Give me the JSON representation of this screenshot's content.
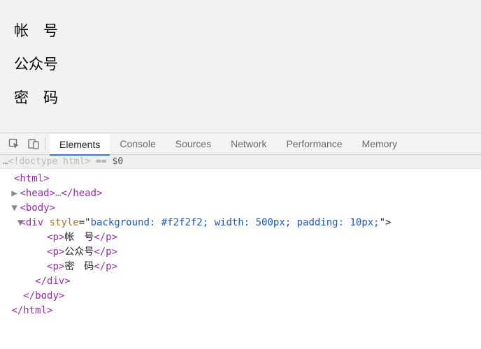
{
  "preview": {
    "p1": "帐　号",
    "p2": "公众号",
    "p3": "密　码"
  },
  "devtools": {
    "tabs": {
      "elements": "Elements",
      "console": "Console",
      "sources": "Sources",
      "network": "Network",
      "performance": "Performance",
      "memory": "Memory"
    },
    "breadcrumb": {
      "ellipsis": "…",
      "doctype": "<!doctype html>",
      "eq": " == ",
      "sel": "$0"
    },
    "dom": {
      "html_open": "<html>",
      "head_open": "<head>",
      "head_ellipsis": "…",
      "head_close": "</head>",
      "body_open": "<body>",
      "div_open_tag": "<div",
      "div_attr_name": " style",
      "div_attr_eq": "=\"",
      "div_attr_val": "background: #f2f2f2; width: 500px; padding: 10px;",
      "div_attr_close": "\">",
      "p1_open": "<p>",
      "p1_text": "帐　号",
      "p1_close": "</p>",
      "p2_open": "<p>",
      "p2_text": "公众号",
      "p2_close": "</p>",
      "p3_open": "<p>",
      "p3_text": "密　码",
      "p3_close": "</p>",
      "div_close": "</div>",
      "body_close": "</body>",
      "html_close": "</html>"
    }
  }
}
